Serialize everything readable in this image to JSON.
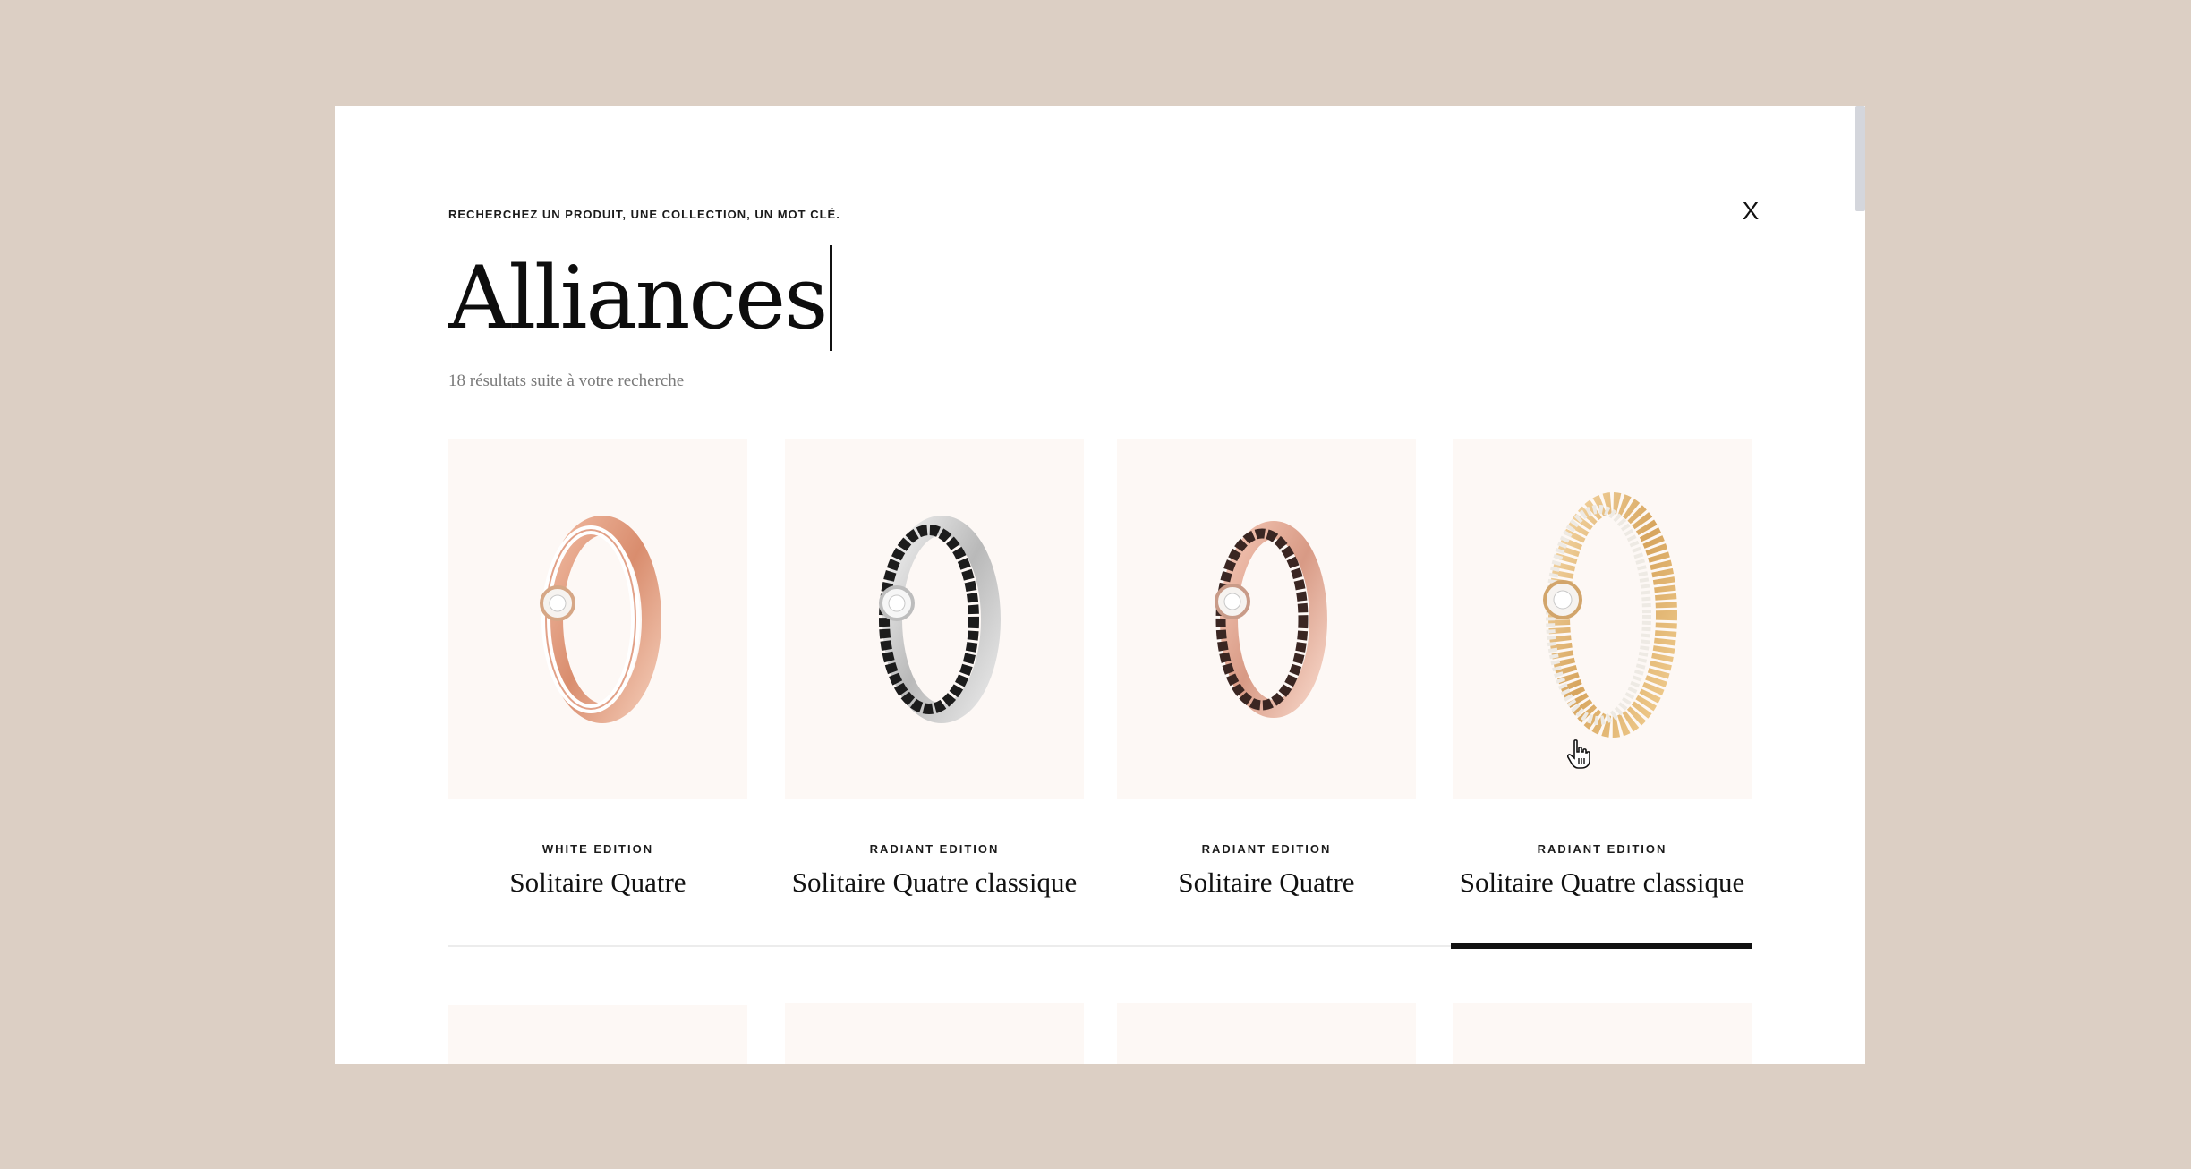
{
  "search": {
    "label": "RECHERCHEZ UN PRODUIT, UNE COLLECTION, UN MOT CLÉ.",
    "query": "Alliances",
    "close_label": "X",
    "results_count": "18 résultats suite à votre recherche"
  },
  "results": [
    {
      "edition": "WHITE EDITION",
      "name": "Solitaire Quatre",
      "image_icon": "rose-gold-white-ring"
    },
    {
      "edition": "RADIANT EDITION",
      "name": "Solitaire Quatre classique",
      "image_icon": "white-gold-black-ring"
    },
    {
      "edition": "RADIANT EDITION",
      "name": "Solitaire Quatre",
      "image_icon": "rose-gold-brown-ring"
    },
    {
      "edition": "RADIANT EDITION",
      "name": "Solitaire Quatre classique",
      "image_icon": "yellow-gold-diamond-ring"
    }
  ],
  "colors": {
    "background": "#dccfc4",
    "card_background": "#fdf8f5",
    "accent": "#111111"
  }
}
